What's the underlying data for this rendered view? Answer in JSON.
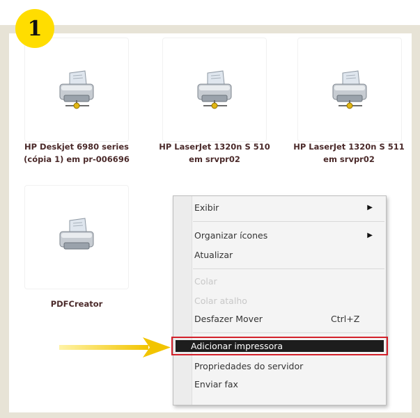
{
  "step_number": "1",
  "printers": [
    {
      "line1": "HP Deskjet 6980 series",
      "line2": "(cópia 1) em pr-006696",
      "icon": "network-printer-icon"
    },
    {
      "line1": "HP LaserJet 1320n S 510",
      "line2": "em srvpr02",
      "icon": "network-printer-icon"
    },
    {
      "line1": "HP LaserJet 1320n S 511",
      "line2": "em srvpr02",
      "icon": "network-printer-icon"
    },
    {
      "line1": "PDFCreator",
      "line2": "",
      "icon": "printer-icon"
    }
  ],
  "context_menu": {
    "exibir": "Exibir",
    "organizar": "Organizar ícones",
    "atualizar": "Atualizar",
    "colar": "Colar",
    "colar_atalho": "Colar atalho",
    "desfazer": "Desfazer Mover",
    "desfazer_shortcut": "Ctrl+Z",
    "adicionar": "Adicionar impressora",
    "propriedades": "Propriedades do servidor",
    "enviar_fax": "Enviar fax"
  },
  "colors": {
    "frame": "#e7e3d6",
    "badge": "#ffdd00",
    "highlight_outline": "#d3202a",
    "selected_item_bg": "#1d1d1d",
    "pointer_arrow": "#f2c400",
    "label_text": "#4b2a2a"
  }
}
